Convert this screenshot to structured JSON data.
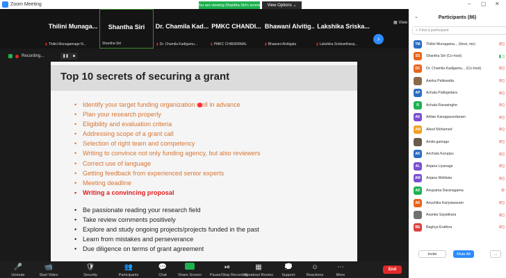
{
  "window": {
    "title": "Zoom Meeting"
  },
  "banner": {
    "viewing": "You are viewing Shantha Siri's screen",
    "view_options": "View Options ⌄"
  },
  "video_strip": {
    "view_label": "View",
    "tiles": [
      {
        "name": "Thilini Munaga...",
        "sub": "Thilini Munagamage N...",
        "muted": true
      },
      {
        "name": "Shantha Siri",
        "sub": "Shantha Siri",
        "muted": false
      },
      {
        "name": "Dr. Chamila Kad...",
        "sub": "Dr. Chamila Kadigamu...",
        "muted": true
      },
      {
        "name": "PMKC CHANDI...",
        "sub": "PMKC CHANDRMAL",
        "muted": true
      },
      {
        "name": "Bhawani Alvitig...",
        "sub": "Bhawani Alvitigala",
        "muted": true
      },
      {
        "name": "Lakshika Sriska...",
        "sub": "Lakshika Sriskantharaj...",
        "muted": true
      }
    ]
  },
  "recording": {
    "label": "Recording..."
  },
  "slide": {
    "title": "Top 10 secrets of securing a grant",
    "orange_items": [
      {
        "text": "Identify your target funding organization well in advance",
        "hl": false
      },
      {
        "text": "Plan your research properly",
        "hl": false
      },
      {
        "text": "Eligibility and evaluation criteria",
        "hl": false
      },
      {
        "text": "Addressing scope of a grant call",
        "hl": false
      },
      {
        "text": "Selection of right team and competency",
        "hl": false
      },
      {
        "text": "Writing to convince not only funding agency, but also reviewers",
        "hl": false
      },
      {
        "text": "Correct use of language",
        "hl": false
      },
      {
        "text": "Getting feedback from experienced senior experts",
        "hl": false
      },
      {
        "text": "Meeting deadline",
        "hl": false
      },
      {
        "text": "Writing a convincing proposal",
        "hl": true
      }
    ],
    "black_items": [
      "Be passionate reading your research field",
      "Take review comments positively",
      "Explore and study ongoing projects/projects funded in the past",
      "Learn from mistakes and perseverance",
      "Due diligence on terms of grant agreement"
    ]
  },
  "toolbar": {
    "items": [
      {
        "icon": "🎤",
        "label": "Unmute"
      },
      {
        "icon": "📹",
        "label": "Start Video"
      },
      {
        "icon": "🛡",
        "label": "Security"
      },
      {
        "icon": "👥",
        "label": "Participants"
      },
      {
        "icon": "💬",
        "label": "Chat"
      },
      {
        "icon": "",
        "label": "Share Screen"
      },
      {
        "icon": "⏯",
        "label": "Pause/Stop Recording"
      },
      {
        "icon": "▦",
        "label": "Breakout Rooms"
      },
      {
        "icon": "💭",
        "label": "Support"
      },
      {
        "icon": "☺",
        "label": "Reactions"
      },
      {
        "icon": "⋯",
        "label": "More"
      }
    ],
    "end_label": "End"
  },
  "panel": {
    "title": "Participants (86)",
    "search_placeholder": "Find a participant",
    "participants": [
      {
        "initials": "TM",
        "color": "#2d6cc0",
        "name": "Thilini Munagama... (Host, me)"
      },
      {
        "initials": "SS",
        "color": "#e8641a",
        "name": "Shantha Siri (Co-host)"
      },
      {
        "initials": "DC",
        "color": "#e8641a",
        "name": "Dr. Chamila Kadigamu... (Co-host)"
      },
      {
        "initials": "",
        "color": "#8a6a4a",
        "name": "Aanka Pallewatta"
      },
      {
        "initials": "AP",
        "color": "#2d6cc0",
        "name": "Achala Pallegedara"
      },
      {
        "initials": "R",
        "color": "#1fb14f",
        "name": "Achala Ranasinghe"
      },
      {
        "initials": "AK",
        "color": "#7b4ed0",
        "name": "Ahilan Kanagasundaram"
      },
      {
        "initials": "AM",
        "color": "#f0a020",
        "name": "Akeel Mohamed"
      },
      {
        "initials": "",
        "color": "#6a5a4a",
        "name": "Amila gamage"
      },
      {
        "initials": "AK",
        "color": "#2d6cc0",
        "name": "Anchala Kuruppu"
      },
      {
        "initials": "AL",
        "color": "#7b4ed0",
        "name": "Anjana Liyanage"
      },
      {
        "initials": "AW",
        "color": "#7b4ed0",
        "name": "Anjana Welikala"
      },
      {
        "initials": "AD",
        "color": "#1fb14f",
        "name": "Anupama Daranagama"
      },
      {
        "initials": "AK",
        "color": "#e8641a",
        "name": "Anushika Kariyawasam"
      },
      {
        "initials": "",
        "color": "#707070",
        "name": "Asanka Sayakkara"
      },
      {
        "initials": "BE",
        "color": "#e04040",
        "name": "Baghya Erathna"
      }
    ],
    "invite_label": "Invite",
    "mute_all_label": "Mute All",
    "more_label": "..."
  }
}
